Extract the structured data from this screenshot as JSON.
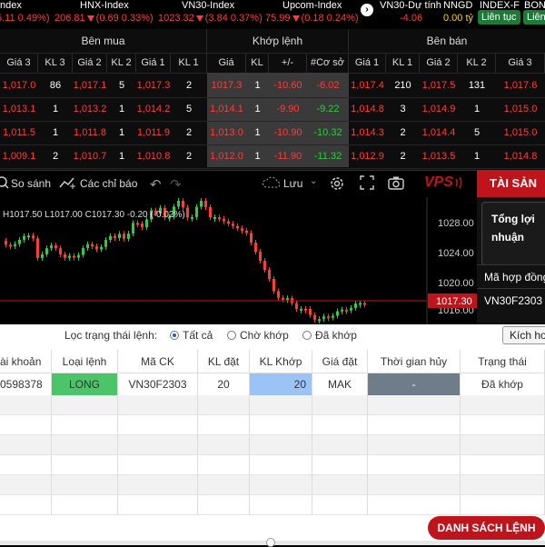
{
  "index_bar": {
    "items": [
      {
        "name": "ndex",
        "value": "5.11 0.49%)"
      },
      {
        "name": "HNX-Index",
        "value": "206.81",
        "change": "(0.69 0.33%)"
      },
      {
        "name": "VN30-Index",
        "value": "1023.32",
        "change": "(3.84 0.37%)"
      },
      {
        "name": "Upcom-Index",
        "value": "75.99",
        "change": "(0.18 0.24%)"
      }
    ],
    "vn30_forecast": {
      "name": "VN30-Dự tính",
      "value": "-4.06"
    },
    "nngd": {
      "name": "NNGD",
      "value": "0.00 tỷ"
    },
    "index_f": {
      "name": "INDEX-F",
      "pill": "Liên tục"
    },
    "bon": {
      "name": "BON",
      "pill": "Liên"
    }
  },
  "order_book": {
    "groups": {
      "buy": "Bên mua",
      "match": "Khớp lệnh",
      "sell": "Bên bán"
    },
    "columns": [
      "Giá 3",
      "KL 3",
      "Giá 2",
      "KL 2",
      "Giá 1",
      "KL 1",
      "Giá",
      "KL",
      "+/-",
      "#Cơ sở",
      "Giá 1",
      "KL 1",
      "Giá 2",
      "KL 2",
      "Giá 3"
    ],
    "rows": [
      [
        "1,017.0",
        "86",
        "1,017.1",
        "5",
        "1,017.3",
        "2",
        "1017.3",
        "1",
        "-10.60",
        "-6.02",
        "1,017.4",
        "210",
        "1,017.5",
        "131",
        "1,017.6"
      ],
      [
        "1,013.1",
        "1",
        "1,013.2",
        "1",
        "1,014.2",
        "5",
        "1,014.1",
        "1",
        "-9.90",
        "-9.22",
        "1,014.8",
        "3",
        "1,014.9",
        "1",
        "1,015.0"
      ],
      [
        "1,011.5",
        "1",
        "1,011.8",
        "1",
        "1,011.9",
        "2",
        "1,013.0",
        "1",
        "-10.90",
        "-10.32",
        "1,014.3",
        "2",
        "1,014.4",
        "5",
        "1,015.0"
      ],
      [
        "1,009.1",
        "2",
        "1,010.7",
        "1",
        "1,010.8",
        "2",
        "1,012.0",
        "1",
        "-11.90",
        "-11.32",
        "1,012.9",
        "2",
        "1,013.5",
        "1",
        "1,014.8"
      ]
    ]
  },
  "chart_toolbar": {
    "compare": "So sánh",
    "indicators": "Các chỉ báo",
    "save": "Lưu",
    "brand": "VPS"
  },
  "chart": {
    "ohlc_text": "H1017.50 L1017.00 C1017.30 -0.20 (-0.02%)",
    "price_labels": [
      "1028.00",
      "1024.00",
      "1020.00",
      "1016.00"
    ],
    "current_price": "1017.30"
  },
  "right_panel": {
    "tab": "TÀI SẢN",
    "pnl_label_1": "Tổng lợi",
    "pnl_label_2": "nhuận",
    "contract_label": "Mã hợp đồng",
    "contract_value": "VN30F2303"
  },
  "orders": {
    "filter_label": "Lọc trạng thái lệnh:",
    "filter_options": [
      "Tất cả",
      "Chờ khớp",
      "Đã khớp"
    ],
    "filter_selected": "Tất cả",
    "activate_btn": "Kích ho",
    "columns": [
      "ài khoản",
      "Loại lệnh",
      "Mã CK",
      "KL đặt",
      "KL Khớp",
      "Giá đặt",
      "Thời gian hủy",
      "Trạng thái"
    ],
    "rows": [
      {
        "account": "0598378",
        "type": "LONG",
        "symbol": "VN30F2303",
        "qty": "20",
        "matched": "20",
        "price": "MAK",
        "cancel_time": "-",
        "status": "Đã khớp"
      }
    ],
    "list_button": "DANH SÁCH LỆNH"
  },
  "colors": {
    "up": "#2ecc40",
    "down": "#ff3b3b",
    "brand": "#c0141c",
    "long": "#4cc46a",
    "matched": "#9cc3f5"
  }
}
